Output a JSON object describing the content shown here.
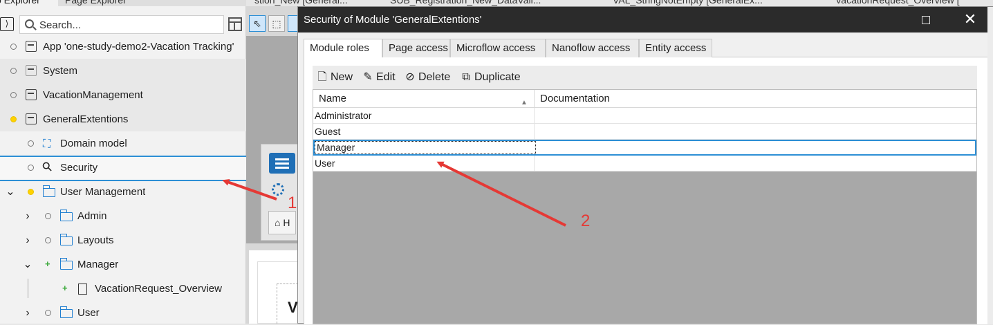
{
  "explorer": {
    "tabs": [
      "p Explorer",
      "Page Explorer"
    ],
    "search_placeholder": "Search...",
    "tree": [
      {
        "label": "App 'one-study-demo2-Vacation Tracking'",
        "icon": "app-cube-icon"
      },
      {
        "label": "System",
        "icon": "module-icon"
      },
      {
        "label": "VacationManagement",
        "icon": "module-icon"
      },
      {
        "label": "GeneralExtentions",
        "icon": "module-icon"
      },
      {
        "label": "Domain model",
        "icon": "domain-model-icon"
      },
      {
        "label": "Security",
        "icon": "security-key-icon"
      },
      {
        "label": "User Management",
        "icon": "folder-icon"
      },
      {
        "label": "Admin",
        "icon": "folder-icon"
      },
      {
        "label": "Layouts",
        "icon": "folder-icon"
      },
      {
        "label": "Manager",
        "icon": "folder-icon"
      },
      {
        "label": "VacationRequest_Overview",
        "icon": "page-icon"
      },
      {
        "label": "User",
        "icon": "folder-icon"
      }
    ]
  },
  "doc_tabs": [
    "stion_New [General...",
    "SUB_Registration_New_DataVali...",
    "VAL_StringNotEmpty [GeneralEx...",
    "VacationRequest_Overview ["
  ],
  "editor_preview": {
    "home_label": "H",
    "heading": "V"
  },
  "dialog": {
    "title": "Security of Module 'GeneralExtentions'",
    "close_glyph": "✕",
    "tabs": [
      "Module roles",
      "Page access",
      "Microflow access",
      "Nanoflow access",
      "Entity access"
    ],
    "active_tab": "Module roles",
    "actions": {
      "new": "New",
      "edit": "Edit",
      "delete": "Delete",
      "duplicate": "Duplicate"
    },
    "columns": {
      "name": "Name",
      "documentation": "Documentation"
    },
    "rows": [
      {
        "name": "Administrator",
        "documentation": ""
      },
      {
        "name": "Guest",
        "documentation": ""
      },
      {
        "name": "Manager",
        "documentation": ""
      },
      {
        "name": "User",
        "documentation": ""
      }
    ],
    "selected_row": "Manager"
  },
  "annotations": {
    "arrow1_label": "1",
    "arrow2_label": "2",
    "color": "#e53935"
  },
  "colors": {
    "accent": "#2d8fd5",
    "title_bar": "#2b2b2b",
    "folder": "#1f7ed0"
  }
}
